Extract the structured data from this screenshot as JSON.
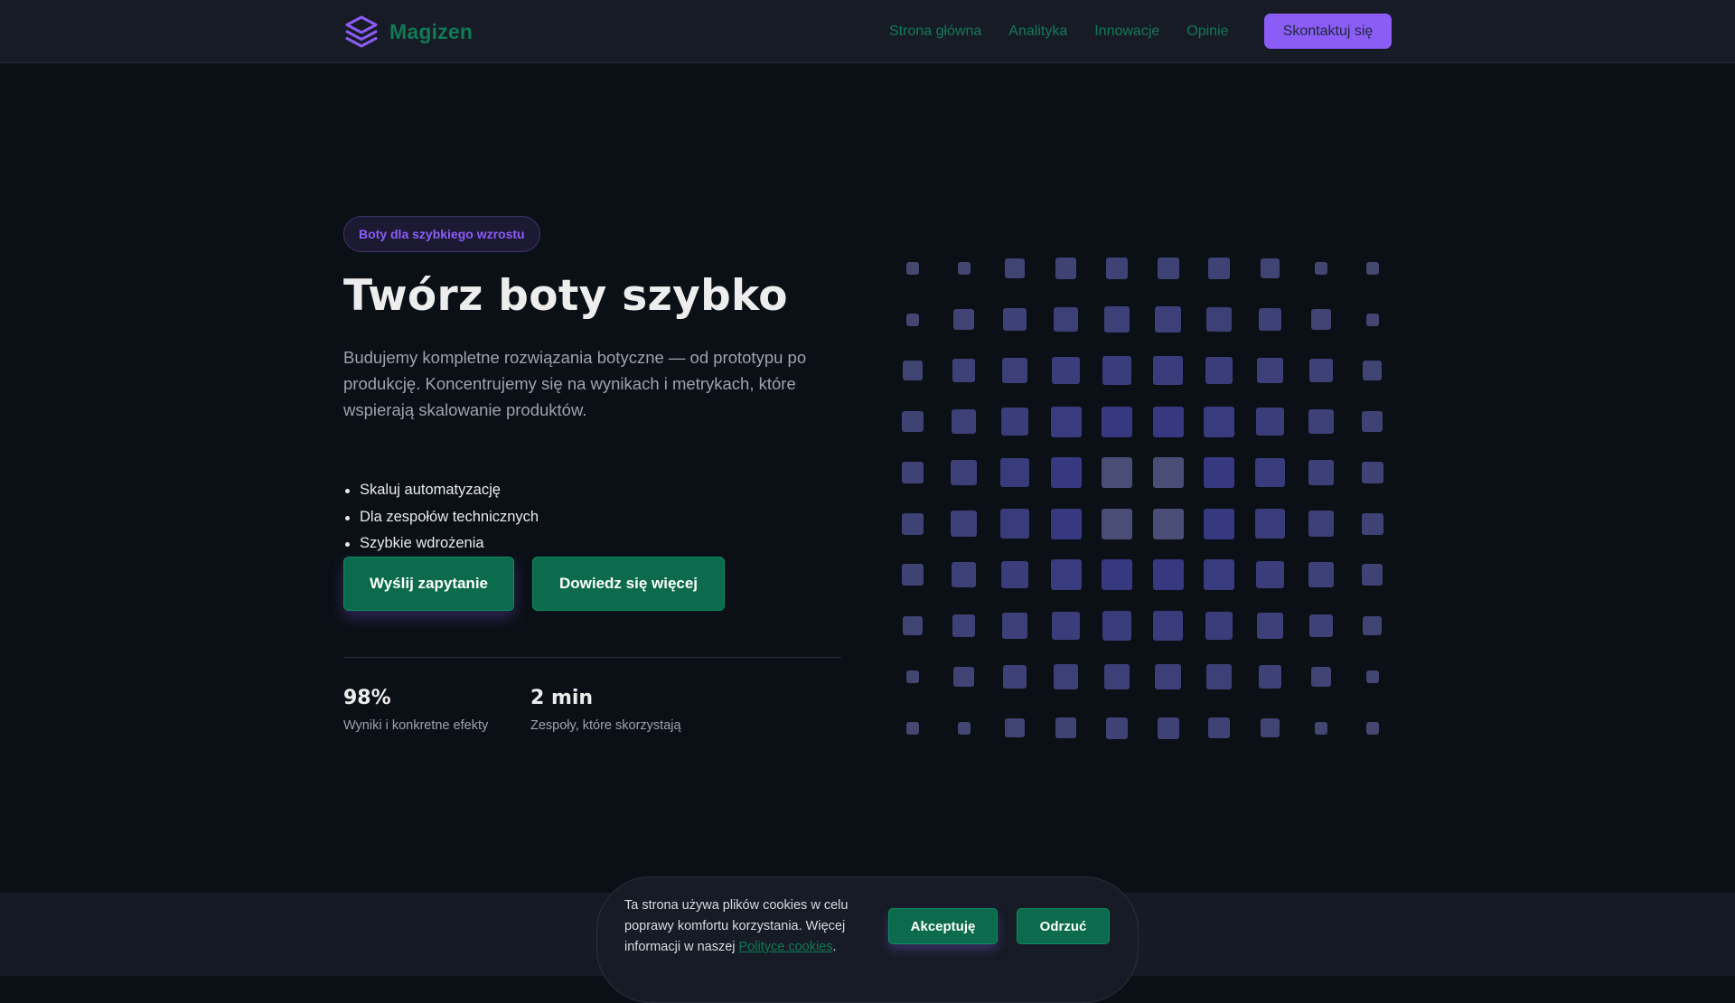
{
  "header": {
    "brand": "Magizen",
    "nav": [
      "Strona główna",
      "Analityka",
      "Innowacje",
      "Opinie"
    ],
    "cta": "Skontaktuj się"
  },
  "hero": {
    "badge": "Boty dla szybkiego wzrostu",
    "title": "Twórz boty szybko",
    "lead": "Budujemy kompletne rozwiązania botyczne — od prototypu po produkcję. Koncentrujemy się na wynikach i metrykach, które wspierają skalowanie produktów.",
    "features": [
      "Skaluj automatyzację",
      "Dla zespołów technicznych",
      "Szybkie wdrożenia"
    ],
    "primary_button": "Wyślij zapytanie",
    "secondary_button": "Dowiedz się więcej"
  },
  "stats": [
    {
      "value": "98%",
      "label": "Wyniki i konkretne efekty"
    },
    {
      "value": "2 min",
      "label": "Zespoły, które skorzystają"
    }
  ],
  "cookie": {
    "text_before": "Ta strona używa plików cookies w celu poprawy komfortu korzystania. Więcej informacji w naszej ",
    "link": "Polityce cookies",
    "text_after": ".",
    "accept": "Akceptuję",
    "reject": "Odrzuć"
  },
  "colors": {
    "accent_purple": "#8b5cf6",
    "accent_green": "#0b6b4c",
    "background": "#0b1016"
  },
  "icons": {
    "brand": "stacked-layers-icon"
  }
}
